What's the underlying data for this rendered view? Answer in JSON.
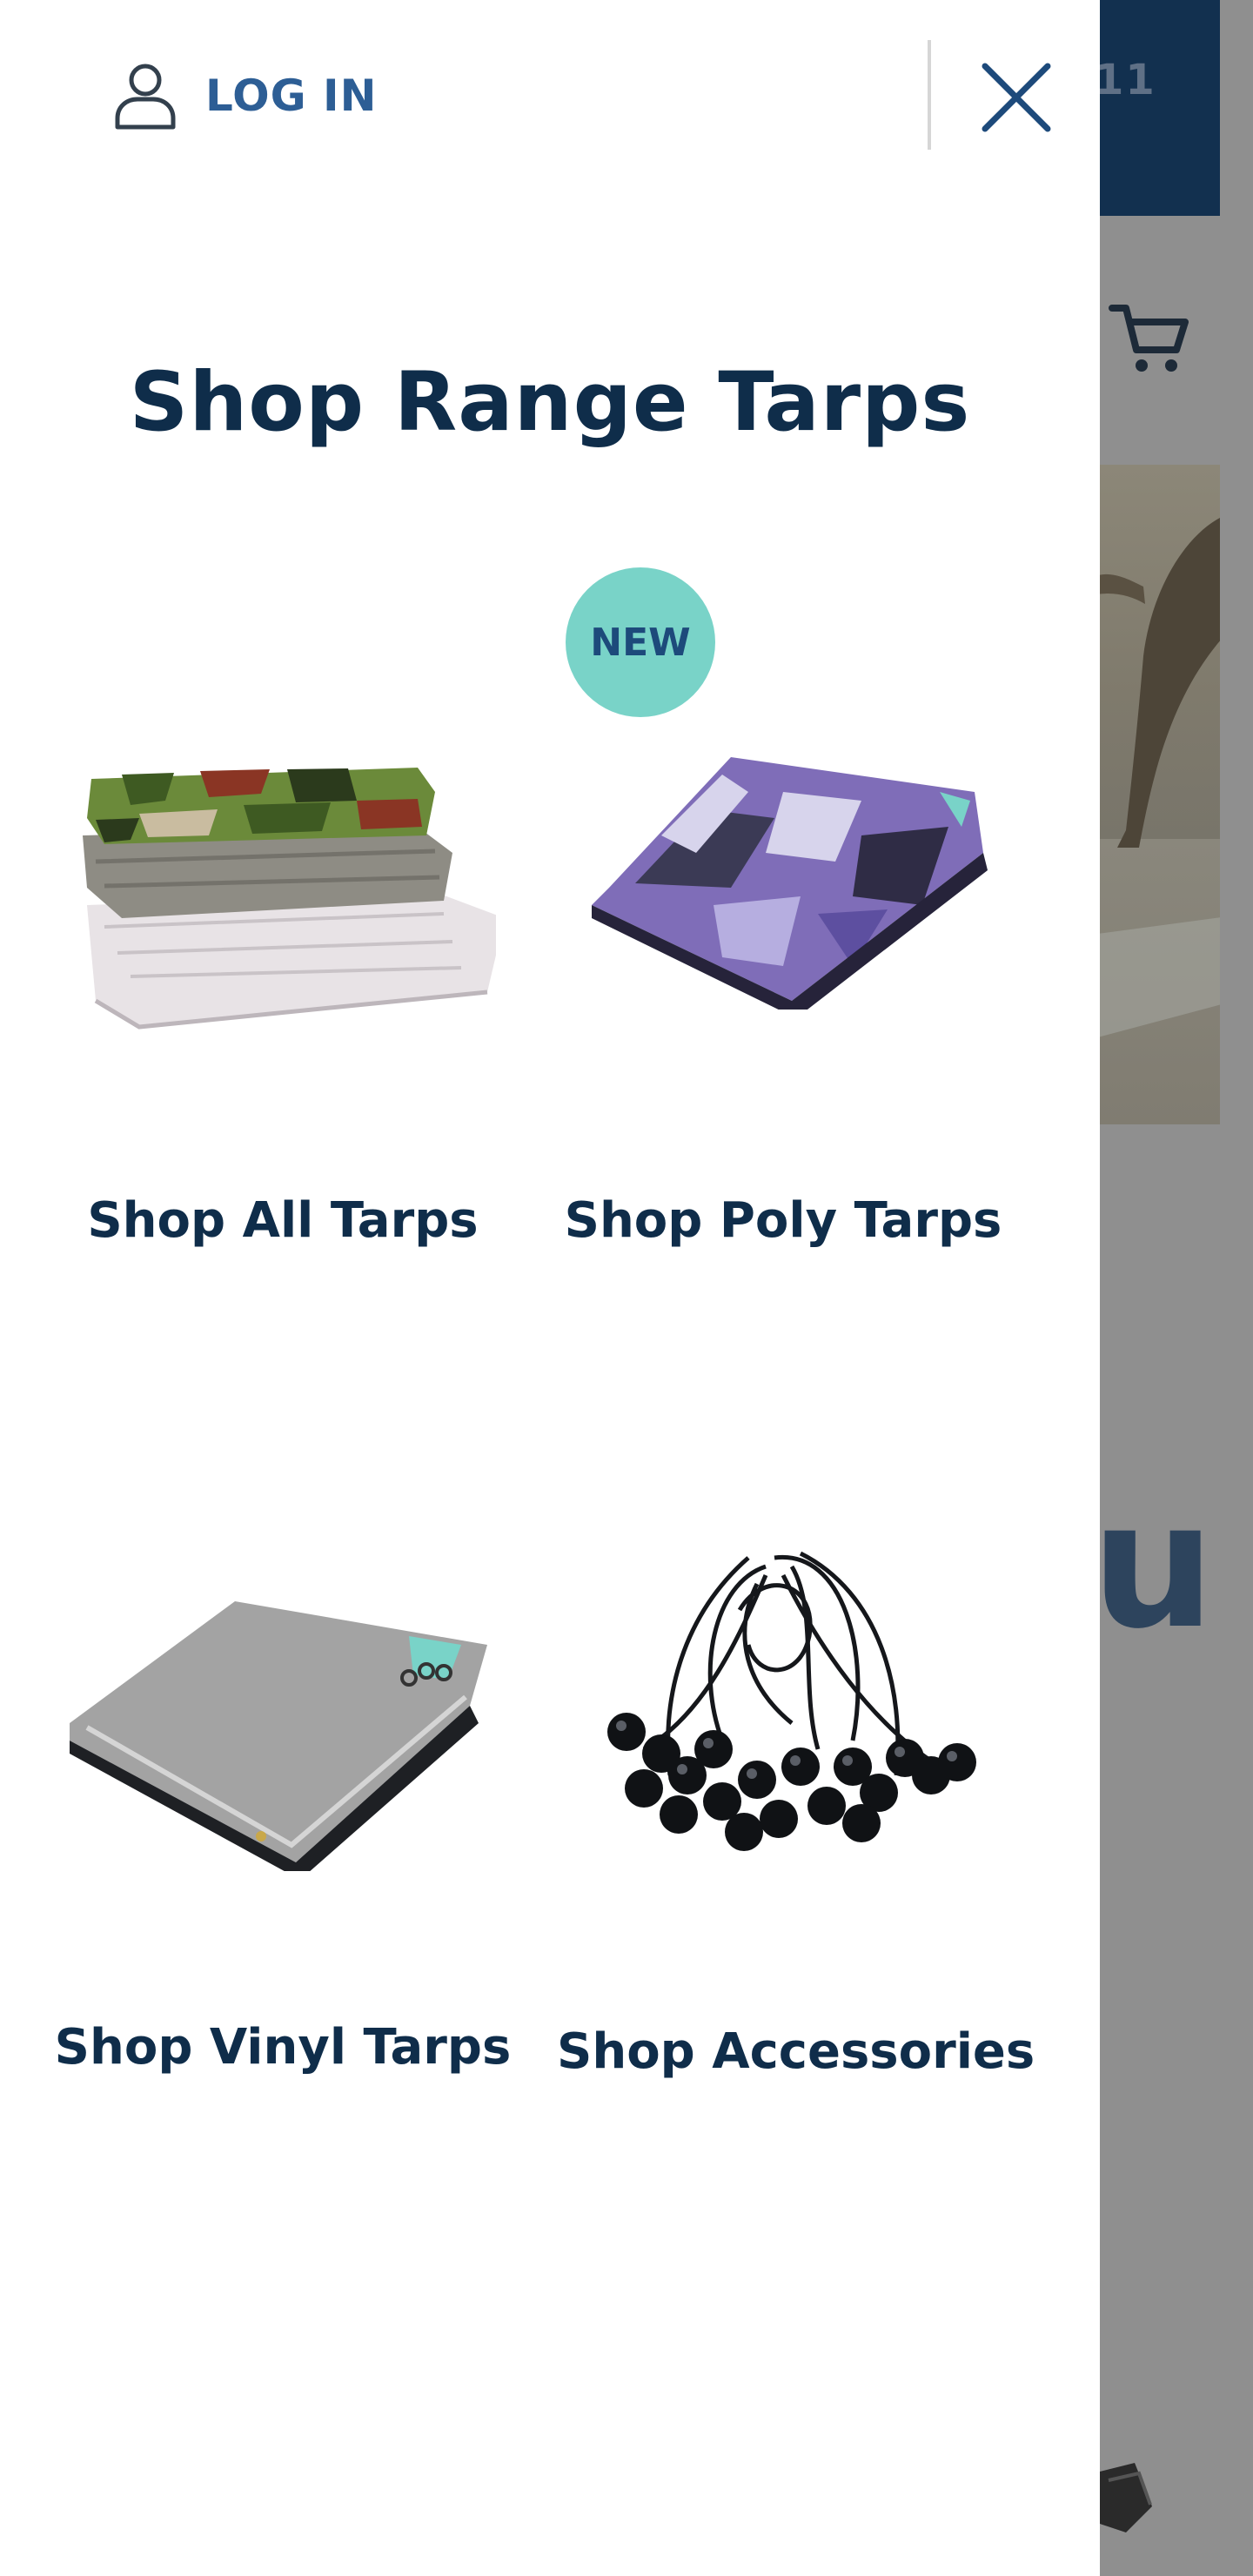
{
  "drawer": {
    "login_label": "LOG IN",
    "title": "Shop Range Tarps",
    "badge": "NEW",
    "items": [
      {
        "label": "Shop All Tarps",
        "icon": "stacked-tarps-image"
      },
      {
        "label": "Shop Poly Tarps",
        "icon": "camo-poly-tarp-image"
      },
      {
        "label": "Shop Vinyl Tarps",
        "icon": "grey-vinyl-tarp-image"
      },
      {
        "label": "Shop Accessories",
        "icon": "ball-bungees-image"
      }
    ]
  },
  "background": {
    "header_fragment": "11",
    "heading_fragment": "u"
  },
  "colors": {
    "navy": "#0f2d4a",
    "link_blue": "#2d5e95",
    "badge_teal": "#79d3c8",
    "overlay_grey": "#8f8f8f"
  }
}
